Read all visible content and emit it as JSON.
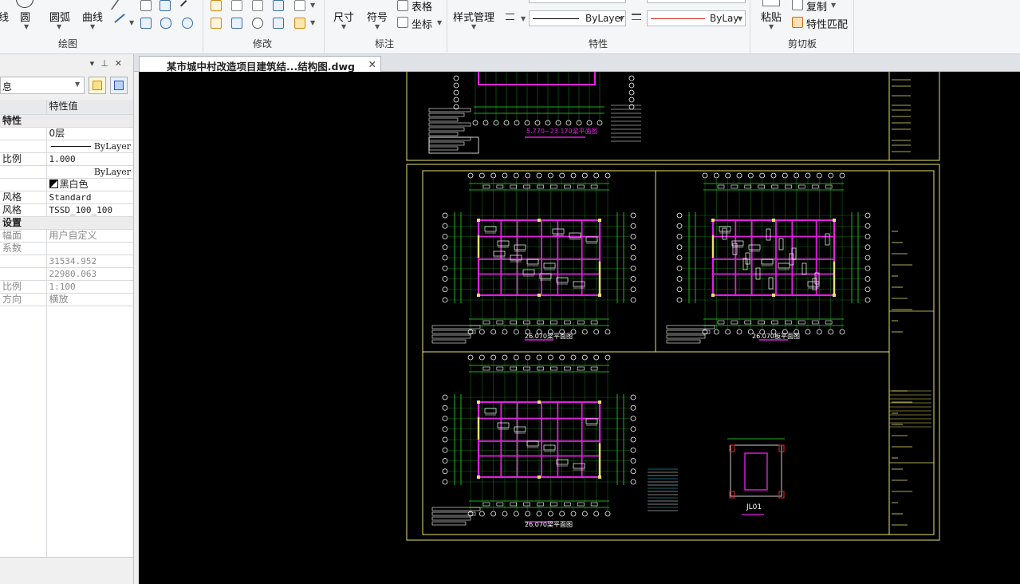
{
  "ribbon": {
    "draw_buttons": [
      "线",
      "圆",
      "圆弧",
      "曲线"
    ],
    "draw_group": "绘图",
    "modify_group": "修改",
    "dim_buttons": [
      "尺寸",
      "符号"
    ],
    "table_label": "表格",
    "coord_label": "坐标",
    "annotate_group": "标注",
    "style_manager": "样式管理",
    "linetype_value": "ByLayer",
    "lineweight_value": "ByLay",
    "properties_group": "特性",
    "paste_label": "粘贴",
    "copy_label": "复制",
    "match_prop_label": "特性匹配",
    "clipboard_group": "剪切板"
  },
  "panel": {
    "header_icons": [
      "▾",
      "⊥",
      "✕"
    ],
    "selector_value": "息",
    "col_header": "特性值",
    "rows": [
      {
        "k": "特性",
        "v": "",
        "type": "cat"
      },
      {
        "k": "",
        "v": "0层",
        "type": "row"
      },
      {
        "k": "",
        "v": "ByLayer",
        "type": "line"
      },
      {
        "k": "比例",
        "v": "1.000",
        "type": "mono"
      },
      {
        "k": "",
        "v": "ByLayer",
        "type": "weight"
      },
      {
        "k": "",
        "v": "黑白色",
        "type": "color"
      },
      {
        "k": "风格",
        "v": "Standard",
        "type": "mono"
      },
      {
        "k": "风格",
        "v": "TSSD_100_100",
        "type": "mono"
      },
      {
        "k": "设置",
        "v": "",
        "type": "cat"
      },
      {
        "k": "幅面",
        "v": "用户自定义",
        "type": "dim"
      },
      {
        "k": "系数",
        "v": "",
        "type": "dim"
      },
      {
        "k": "",
        "v": "31534.952",
        "type": "dimmono"
      },
      {
        "k": "",
        "v": "22980.063",
        "type": "dimmono"
      },
      {
        "k": "比例",
        "v": "1:100",
        "type": "dimmono"
      },
      {
        "k": "方向",
        "v": "横放",
        "type": "dim"
      }
    ]
  },
  "doc_tab": {
    "title": "某市城中村改造项目建筑结...结构图.dwg",
    "close": "✕"
  },
  "drawing": {
    "top_caption": "5.770~23.170梁平面图",
    "plan_captions": [
      "26.070梁平面图",
      "26.070板平面图",
      "26.070梁平面图",
      "JL01"
    ]
  },
  "colors": {
    "frame": "#e8e36a",
    "magenta": "#e020e0",
    "green": "#22e622",
    "white": "#ffffff",
    "cyan": "#30d0e8",
    "red": "#ff2020"
  }
}
